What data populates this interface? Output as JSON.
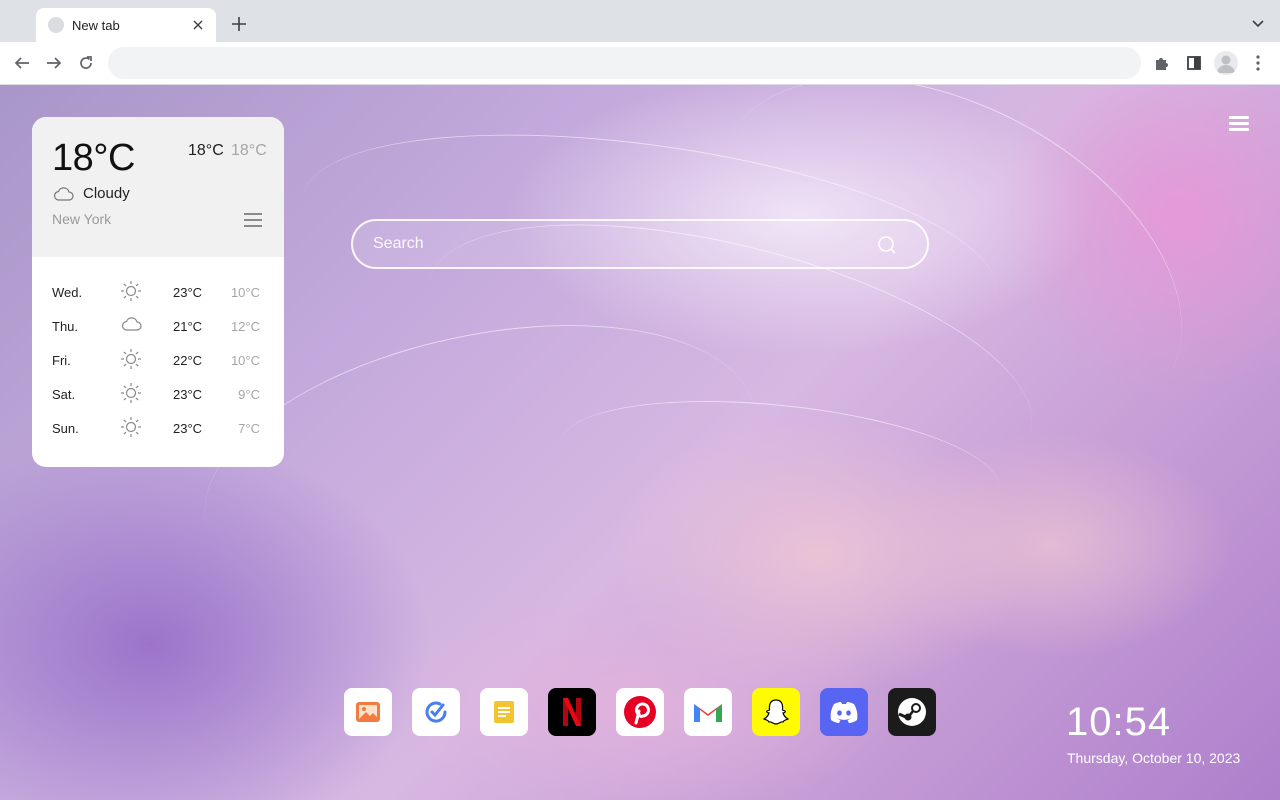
{
  "browser": {
    "tab_title": "New tab",
    "address_value": "",
    "address_placeholder": ""
  },
  "weather": {
    "current_temp": "18°C",
    "high": "18°C",
    "low": "18°C",
    "condition": "Cloudy",
    "condition_icon": "cloud-icon",
    "city": "New York",
    "forecast": [
      {
        "day": "Wed.",
        "icon": "sun-icon",
        "high": "23°C",
        "low": "10°C"
      },
      {
        "day": "Thu.",
        "icon": "cloud-icon",
        "high": "21°C",
        "low": "12°C"
      },
      {
        "day": "Fri.",
        "icon": "sun-icon",
        "high": "22°C",
        "low": "10°C"
      },
      {
        "day": "Sat.",
        "icon": "sun-icon",
        "high": "23°C",
        "low": "9°C"
      },
      {
        "day": "Sun.",
        "icon": "sun-icon",
        "high": "23°C",
        "low": "7°C"
      }
    ]
  },
  "search": {
    "placeholder": "Search"
  },
  "dock": [
    {
      "name": "photos",
      "icon": "photo-icon",
      "bg": "#ffffff"
    },
    {
      "name": "tasks",
      "icon": "check-circle-icon",
      "bg": "#ffffff"
    },
    {
      "name": "notes",
      "icon": "notes-icon",
      "bg": "#ffffff"
    },
    {
      "name": "netflix",
      "icon": "netflix-icon",
      "bg": "#000000"
    },
    {
      "name": "pinterest",
      "icon": "pinterest-icon",
      "bg": "#ffffff"
    },
    {
      "name": "gmail",
      "icon": "gmail-icon",
      "bg": "#ffffff"
    },
    {
      "name": "snapchat",
      "icon": "snapchat-icon",
      "bg": "#fffc00"
    },
    {
      "name": "discord",
      "icon": "discord-icon",
      "bg": "#5865f2"
    },
    {
      "name": "steam",
      "icon": "steam-icon",
      "bg": "#1b1b1b"
    }
  ],
  "clock": {
    "time": "10:54",
    "date": "Thursday, October 10, 2023"
  },
  "colors": {
    "netflix_red": "#e50914",
    "pinterest_red": "#e60023",
    "snapchat_yellow": "#fffc00",
    "discord_blurple": "#5865f2"
  }
}
